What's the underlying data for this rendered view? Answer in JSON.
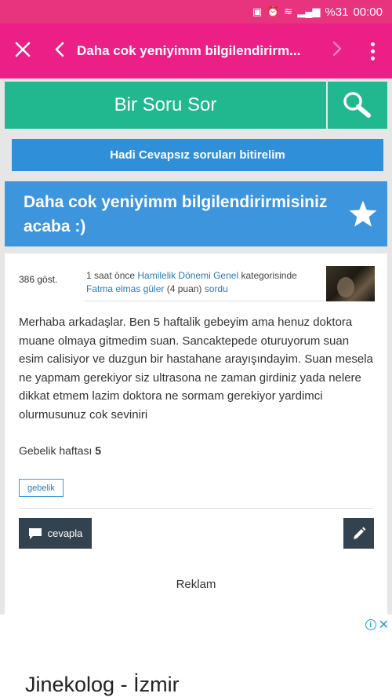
{
  "status_bar": {
    "battery": "%31",
    "time": "00:00"
  },
  "app_bar": {
    "title": "Daha cok yeniyimm bilgilendirirm..."
  },
  "ask_bar": {
    "label": "Bir Soru Sor"
  },
  "unanswered_banner": {
    "label": "Hadi Cevapsız soruları bitirelim"
  },
  "question": {
    "title": "Daha cok yeniyimm bilgilendirirmisiniz acaba :)",
    "views": "386 göst.",
    "time_ago": "1 saat önce",
    "category": "Hamilelik Dönemi Genel",
    "category_suffix": "kategorisinde",
    "author": "Fatma elmas güler",
    "author_points": "(4 puan)",
    "action": "sordu",
    "body": "Merhaba arkadaşlar. Ben 5 haftalik gebeyim ama henuz doktora muane olmaya gitmedim suan.  Sancaktepede oturuyorum suan esim calisiyor ve duzgun bir hastahane arayışındayim. Suan mesela ne yapmam gerekiyor siz ultrasona ne zaman girdiniz yada nelere dikkat etmem lazim doktora ne  sormam gerekiyor yardimci olurmusunuz cok seviniri",
    "extra_label": "Gebelik haftası",
    "extra_value": "5",
    "tag": "gebelik",
    "answer_label": "cevapla"
  },
  "ad": {
    "label": "Reklam",
    "headline": "Jinekolog - İzmir"
  },
  "icons": {
    "close": "close-icon",
    "back": "chevron-left-icon",
    "forward": "chevron-right-icon",
    "more": "more-vertical-icon",
    "search": "search-icon",
    "star": "star-icon",
    "comment": "comment-icon",
    "edit": "pencil-icon"
  },
  "colors": {
    "status_bar": "#e8337f",
    "app_bar": "#ec1f86",
    "ask_bar": "#21b88f",
    "banner": "#2f8fd8",
    "question_title": "#3c95dd",
    "dark_button": "#33424f",
    "link": "#2a7ab8"
  }
}
